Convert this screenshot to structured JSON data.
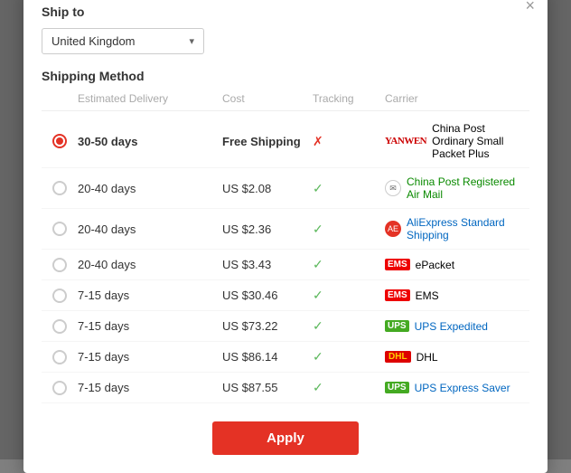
{
  "modal": {
    "close_label": "×",
    "ship_to_title": "Ship to",
    "country": "United Kingdom",
    "shipping_method_title": "Shipping Method",
    "table_headers": {
      "col1": "",
      "estimated_delivery": "Estimated Delivery",
      "cost": "Cost",
      "tracking": "Tracking",
      "carrier": "Carrier"
    },
    "rows": [
      {
        "selected": true,
        "delivery": "30-50 days",
        "cost": "Free Shipping",
        "tracking": "cross",
        "carrier_logo": "YANWEN",
        "carrier_name": "China Post Ordinary Small Packet Plus",
        "carrier_color": "default"
      },
      {
        "selected": false,
        "delivery": "20-40 days",
        "cost": "US $2.08",
        "tracking": "check",
        "carrier_logo": "POST_CIRCLE",
        "carrier_name": "China Post Registered Air Mail",
        "carrier_color": "green"
      },
      {
        "selected": false,
        "delivery": "20-40 days",
        "cost": "US $2.36",
        "tracking": "check",
        "carrier_logo": "AE",
        "carrier_name": "AliExpress Standard Shipping",
        "carrier_color": "blue"
      },
      {
        "selected": false,
        "delivery": "20-40 days",
        "cost": "US $3.43",
        "tracking": "check",
        "carrier_logo": "EMS_RED",
        "carrier_name": "ePacket",
        "carrier_color": "default"
      },
      {
        "selected": false,
        "delivery": "7-15 days",
        "cost": "US $30.46",
        "tracking": "check",
        "carrier_logo": "EMS_RED",
        "carrier_name": "EMS",
        "carrier_color": "default"
      },
      {
        "selected": false,
        "delivery": "7-15 days",
        "cost": "US $73.22",
        "tracking": "check",
        "carrier_logo": "UPS",
        "carrier_name": "UPS Expedited",
        "carrier_color": "blue"
      },
      {
        "selected": false,
        "delivery": "7-15 days",
        "cost": "US $86.14",
        "tracking": "check",
        "carrier_logo": "DHL",
        "carrier_name": "DHL",
        "carrier_color": "default"
      },
      {
        "selected": false,
        "delivery": "7-15 days",
        "cost": "US $87.55",
        "tracking": "check",
        "carrier_logo": "UPS",
        "carrier_name": "UPS Express Saver",
        "carrier_color": "blue"
      }
    ],
    "apply_button": "Apply"
  }
}
